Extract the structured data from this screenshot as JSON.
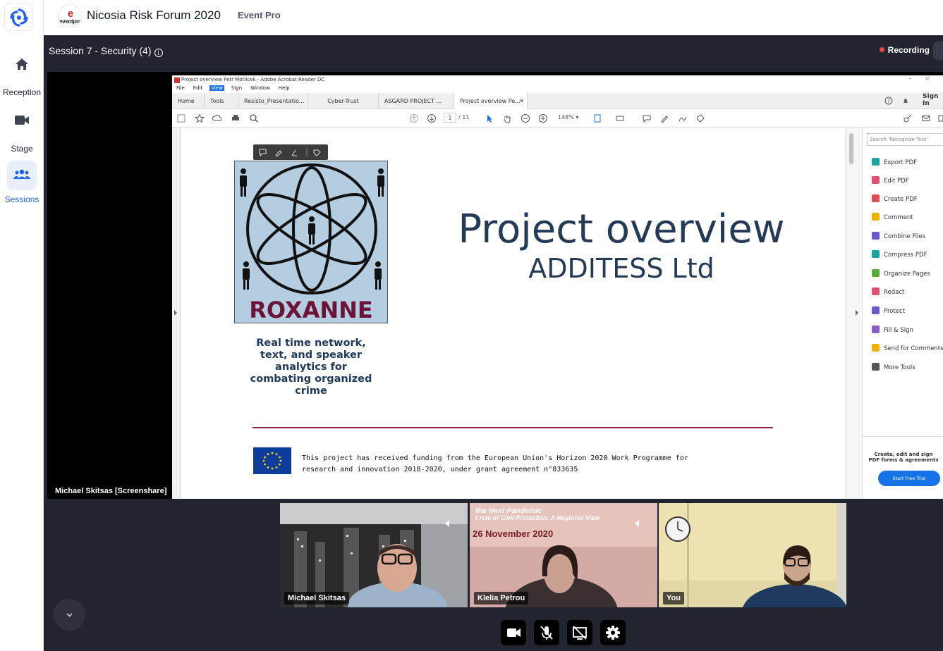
{
  "nav": {
    "items": [
      {
        "label": "Reception",
        "icon": "home-icon"
      },
      {
        "label": "Stage",
        "icon": "video-camera-icon"
      },
      {
        "label": "Sessions",
        "icon": "people-group-icon"
      }
    ]
  },
  "header": {
    "logo_text": "eventpro",
    "event_title": "Nicosia Risk Forum 2020",
    "subtitle": "Event Pro"
  },
  "session": {
    "title": "Session 7 - Security (4)",
    "recording_label": "Recording"
  },
  "screenshare": {
    "presenter_label": "Michael Skitsas [Screenshare]",
    "acrobat": {
      "window_title": "Project overview Petr Motlicek - Adobe Acrobat Reader DC",
      "menu": [
        "File",
        "Edit",
        "View",
        "Sign",
        "Window",
        "Help"
      ],
      "tabs": [
        "Home",
        "Tools",
        "Resisto_Presentatio...",
        "Cyber-Trust",
        "ASGARD PROJECT ...",
        "Project overview Pe..."
      ],
      "sign_in": "Sign In",
      "page_current": "1",
      "page_total": "/ 11",
      "zoom": "148%",
      "search_placeholder": "Search 'Recognize Text'",
      "tools": [
        {
          "label": "Export PDF",
          "color": "#19a3a3"
        },
        {
          "label": "Edit PDF",
          "color": "#e0517a"
        },
        {
          "label": "Create PDF",
          "color": "#e04f4f"
        },
        {
          "label": "Comment",
          "color": "#e8b400"
        },
        {
          "label": "Combine Files",
          "color": "#6a5acd"
        },
        {
          "label": "Compress PDF",
          "color": "#19a3a3"
        },
        {
          "label": "Organize Pages",
          "color": "#59a83a"
        },
        {
          "label": "Redact",
          "color": "#e0517a"
        },
        {
          "label": "Protect",
          "color": "#6a5acd"
        },
        {
          "label": "Fill & Sign",
          "color": "#8a5cc7"
        },
        {
          "label": "Send for Comments",
          "color": "#e8b400"
        },
        {
          "label": "More Tools",
          "color": "#555555"
        }
      ],
      "promo_text": "Create, edit and sign PDF forms & agreements",
      "promo_button": "Start Free Trial"
    },
    "slide": {
      "logo_word": "ROXANNE",
      "tagline": "Real time network, text, and speaker analytics for combating organized crime",
      "title": "Project overview",
      "subtitle": "ADDITESS Ltd",
      "funding_line1": "This project has received funding from the European Union's Horizon 2020 Work Programme for",
      "funding_line2": "research and innovation 2018-2020, under grant agreement n°833635"
    }
  },
  "participants": [
    {
      "name": "Michael Skitsas"
    },
    {
      "name": "Klelia Petrou",
      "banner_line1": "the Next Pandemic",
      "banner_line2": "t role of Civil Protection: A Regional View",
      "banner_date": "26 November 2020"
    },
    {
      "name": "You"
    }
  ],
  "colors": {
    "stage_bg": "#22242f",
    "accent": "#2563eb",
    "recording": "#ef4444"
  }
}
